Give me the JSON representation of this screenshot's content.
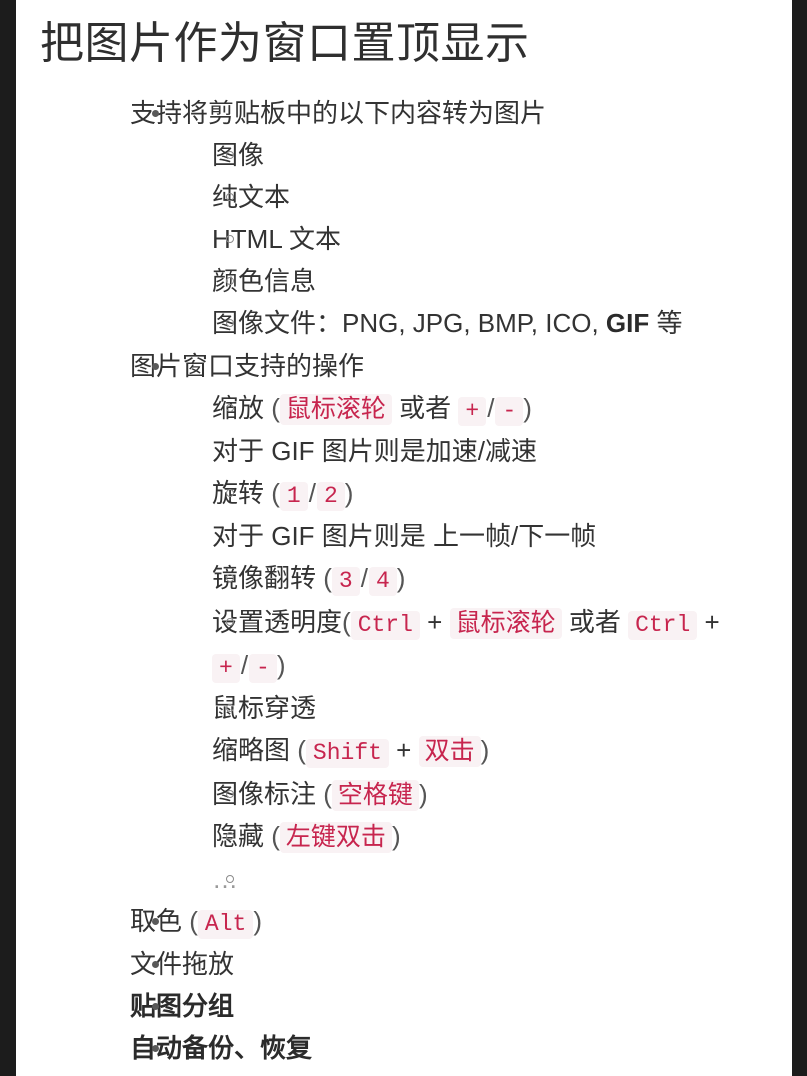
{
  "document": {
    "title": "把图片作为窗口置顶显示",
    "colors": {
      "page_background": "#ffffff",
      "frame_background": "#1c1c1c",
      "text": "#333333",
      "code_text": "#c7254e",
      "code_background": "#f9f2f4",
      "bullet_level1": "#595959",
      "bullet_level2": "#8a8a8a"
    }
  },
  "content": {
    "clipboard_section": {
      "label": "支持将剪贴板中的以下内容转为图片",
      "items": [
        {
          "label": "图像"
        },
        {
          "label": "纯文本"
        },
        {
          "label": "HTML 文本"
        },
        {
          "label": "颜色信息"
        },
        {
          "label_prefix": "图像文件：PNG, JPG, BMP, ICO, ",
          "label_bold": "GIF",
          "label_suffix": " 等"
        }
      ]
    },
    "window_ops_section": {
      "label": "图片窗口支持的操作",
      "items": {
        "zoom": {
          "name": "缩放",
          "open_paren": "(",
          "key_wheel": "鼠标滚轮",
          "or": "或者",
          "key_plus": "+",
          "slash": "/",
          "key_minus": "-",
          "close_paren": ")",
          "subline": "对于 GIF 图片则是加速/减速"
        },
        "rotate": {
          "name": "旋转",
          "open_paren": "(",
          "key_1": "1",
          "slash": "/",
          "key_2": "2",
          "close_paren": ")",
          "subline": "对于 GIF 图片则是 上一帧/下一帧"
        },
        "mirror": {
          "name": "镜像翻转",
          "open_paren": "(",
          "key_3": "3",
          "slash": "/",
          "key_4": "4",
          "close_paren": ")"
        },
        "opacity": {
          "name": "设置透明度",
          "open_paren": "(",
          "key_ctrl_1": "Ctrl",
          "plus_1": "+",
          "key_wheel": "鼠标滚轮",
          "or": "或者",
          "key_ctrl_2": "Ctrl",
          "plus_2": "+",
          "key_plus": "+",
          "slash": "/",
          "key_minus": "-",
          "close_paren": ")"
        },
        "click_through": {
          "name": "鼠标穿透"
        },
        "thumbnail": {
          "name": "缩略图",
          "open_paren": "(",
          "key_shift": "Shift",
          "plus": "+",
          "key_doubleclick": "双击",
          "close_paren": ")"
        },
        "annotate": {
          "name": "图像标注",
          "open_paren": "(",
          "key_space": "空格键",
          "close_paren": ")"
        },
        "hide": {
          "name": "隐藏",
          "open_paren": "(",
          "key_leftdoubleclick": "左键双击",
          "close_paren": ")"
        },
        "more": {
          "name": "…"
        }
      }
    },
    "top_level_items": {
      "color_picker": {
        "name": "取色",
        "open_paren": "(",
        "key_alt": "Alt",
        "close_paren": ")"
      },
      "file_drag": {
        "name": "文件拖放"
      },
      "sticker_group": {
        "name": "贴图分组"
      },
      "auto_backup": {
        "name": "自动备份、恢复"
      }
    }
  }
}
